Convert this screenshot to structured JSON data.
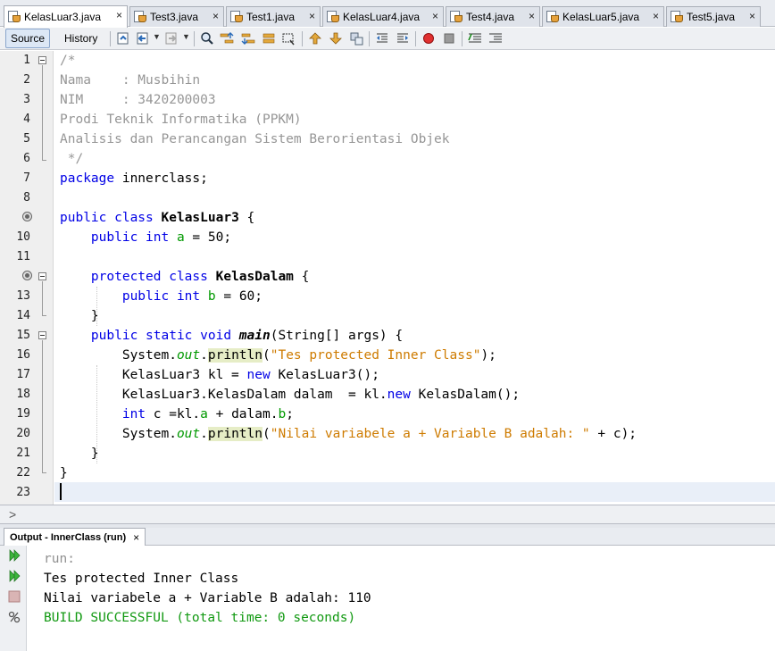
{
  "tabs": [
    {
      "label": "KelasLuar3.java",
      "active": true
    },
    {
      "label": "Test3.java",
      "active": false
    },
    {
      "label": "Test1.java",
      "active": false
    },
    {
      "label": "KelasLuar4.java",
      "active": false
    },
    {
      "label": "Test4.java",
      "active": false
    },
    {
      "label": "KelasLuar5.java",
      "active": false
    },
    {
      "label": "Test5.java",
      "active": false
    }
  ],
  "tab_close_glyph": "×",
  "toolbar": {
    "source_label": "Source",
    "history_label": "History",
    "icons": [
      "last-edit-icon",
      "back-icon",
      "forward-icon",
      "find-icon",
      "find-previous-icon",
      "find-next-icon",
      "find-selection-icon",
      "toggle-highlight-icon",
      "previous-bookmark-icon",
      "next-bookmark-icon",
      "toggle-bookmark-icon",
      "shift-left-icon",
      "shift-right-icon",
      "start-macro-icon",
      "stop-macro-icon",
      "comment-icon",
      "uncomment-icon"
    ]
  },
  "editor": {
    "line_numbers": [
      "1",
      "2",
      "3",
      "4",
      "5",
      "6",
      "7",
      "8",
      "9",
      "10",
      "11",
      "12",
      "13",
      "14",
      "15",
      "16",
      "17",
      "18",
      "19",
      "20",
      "21",
      "22",
      "23"
    ],
    "lines": [
      {
        "n": 1,
        "text": "/*"
      },
      {
        "n": 2,
        "text": "Nama    : Musbihin"
      },
      {
        "n": 3,
        "text": "NIM     : 3420200003"
      },
      {
        "n": 4,
        "text": "Prodi Teknik Informatika (PPKM)"
      },
      {
        "n": 5,
        "text": "Analisis dan Perancangan Sistem Berorientasi Objek"
      },
      {
        "n": 6,
        "text": " */"
      },
      {
        "n": 7,
        "text": "package innerclass;"
      },
      {
        "n": 8,
        "text": ""
      },
      {
        "n": 9,
        "text": "public class KelasLuar3 {"
      },
      {
        "n": 10,
        "text": "    public int a = 50;"
      },
      {
        "n": 11,
        "text": ""
      },
      {
        "n": 12,
        "text": "    protected class KelasDalam {"
      },
      {
        "n": 13,
        "text": "        public int b = 60;"
      },
      {
        "n": 14,
        "text": "    }"
      },
      {
        "n": 15,
        "text": "    public static void main(String[] args) {"
      },
      {
        "n": 16,
        "text": "        System.out.println(\"Tes protected Inner Class\");"
      },
      {
        "n": 17,
        "text": "        KelasLuar3 kl = new KelasLuar3();"
      },
      {
        "n": 18,
        "text": "        KelasLuar3.KelasDalam dalam  = kl.new KelasDalam();"
      },
      {
        "n": 19,
        "text": "        int c =kl.a + dalam.b;"
      },
      {
        "n": 20,
        "text": "        System.out.println(\"Nilai variabele a + Variable B adalah: \" + c);"
      },
      {
        "n": 21,
        "text": "    }"
      },
      {
        "n": 22,
        "text": "}"
      },
      {
        "n": 23,
        "text": ""
      }
    ],
    "caret_line": 23
  },
  "output": {
    "tab_label": "Output - InnerClass (run)",
    "lines": [
      {
        "text": "run:",
        "kind": "dim"
      },
      {
        "text": "Tes protected Inner Class",
        "kind": "normal"
      },
      {
        "text": "Nilai variabele a + Variable B adalah: 110",
        "kind": "normal"
      },
      {
        "text": "BUILD SUCCESSFUL (total time: 0 seconds)",
        "kind": "success"
      }
    ],
    "tool_icons": [
      "rerun-icon",
      "rerun-with-params-icon",
      "stop-icon",
      "settings-icon"
    ]
  },
  "colors": {
    "keyword": "#0000e6",
    "comment": "#969696",
    "string": "#ce7b00",
    "field": "#009900",
    "success": "#119911",
    "current_line": "#e9eff8"
  }
}
